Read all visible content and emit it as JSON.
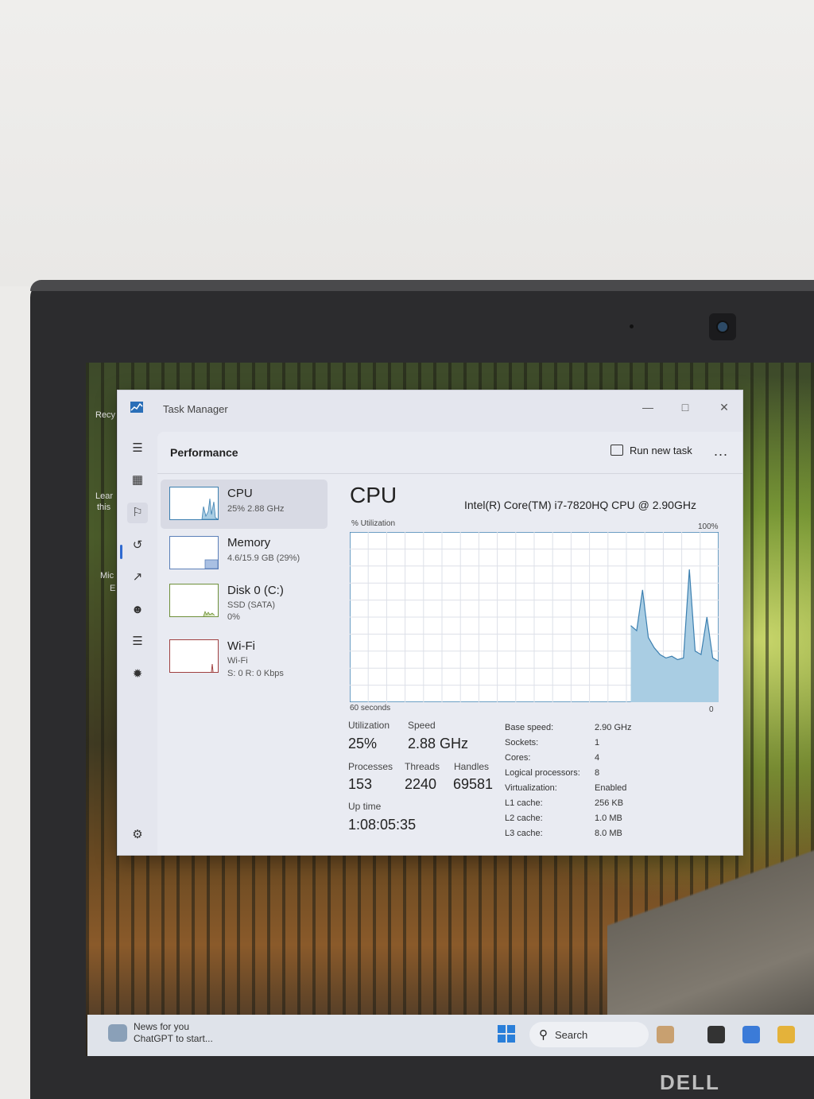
{
  "window": {
    "title": "Task Manager"
  },
  "header": {
    "page_title": "Performance",
    "run_new_task": "Run new task",
    "more": "..."
  },
  "resources": [
    {
      "name": "CPU",
      "line1": "25% 2.88 GHz",
      "line2": ""
    },
    {
      "name": "Memory",
      "line1": "4.6/15.9 GB (29%)",
      "line2": ""
    },
    {
      "name": "Disk 0 (C:)",
      "line1": "SSD (SATA)",
      "line2": "0%"
    },
    {
      "name": "Wi-Fi",
      "line1": "Wi-Fi",
      "line2": "S: 0 R: 0 Kbps"
    }
  ],
  "cpu": {
    "title": "CPU",
    "model": "Intel(R) Core(TM) i7-7820HQ CPU @ 2.90GHz",
    "graph_label_left": "% Utilization",
    "graph_label_right": "100%",
    "graph_time_label": "60 seconds",
    "graph_zero_label": "0",
    "utilization_label": "Utilization",
    "utilization": "25%",
    "speed_label": "Speed",
    "speed": "2.88 GHz",
    "processes_label": "Processes",
    "processes": "153",
    "threads_label": "Threads",
    "threads": "2240",
    "handles_label": "Handles",
    "handles": "69581",
    "uptime_label": "Up time",
    "uptime": "1:08:05:35",
    "details": [
      {
        "label": "Base speed:",
        "value": "2.90 GHz"
      },
      {
        "label": "Sockets:",
        "value": "1"
      },
      {
        "label": "Cores:",
        "value": "4"
      },
      {
        "label": "Logical processors:",
        "value": "8"
      },
      {
        "label": "Virtualization:",
        "value": "Enabled"
      },
      {
        "label": "L1 cache:",
        "value": "256 KB"
      },
      {
        "label": "L2 cache:",
        "value": "1.0 MB"
      },
      {
        "label": "L3 cache:",
        "value": "8.0 MB"
      }
    ],
    "utilization_history": [
      0,
      0,
      0,
      0,
      0,
      0,
      0,
      0,
      0,
      0,
      0,
      0,
      0,
      0,
      0,
      0,
      0,
      0,
      0,
      0,
      0,
      0,
      0,
      0,
      0,
      0,
      0,
      0,
      0,
      0,
      0,
      0,
      0,
      0,
      0,
      0,
      0,
      0,
      0,
      0,
      0,
      0,
      0,
      0,
      0,
      0,
      0,
      0,
      45,
      42,
      66,
      38,
      32,
      28,
      26,
      27,
      25,
      26,
      78,
      30,
      28,
      50,
      26,
      24
    ]
  },
  "taskbar": {
    "news_line1": "News for you",
    "news_line2": "ChatGPT to start...",
    "search_label": "Search"
  },
  "desktop": {
    "icon1": "Recy",
    "icon2": "Lear",
    "icon3": "this",
    "icon4": "Mic",
    "icon5": "E"
  },
  "brand": "DELL",
  "colors": {
    "accent": "#2f6ad0",
    "graph_fill": "#a9cde3",
    "graph_line": "#3b7fb0",
    "grid": "#dde0e8"
  },
  "icons": [
    "hamburger-icon",
    "processes-icon",
    "performance-icon",
    "app-history-icon",
    "startup-apps-icon",
    "users-icon",
    "details-icon",
    "services-icon",
    "settings-icon",
    "run-task-icon",
    "minimize-icon",
    "maximize-icon",
    "close-icon",
    "start-icon",
    "search-icon"
  ]
}
